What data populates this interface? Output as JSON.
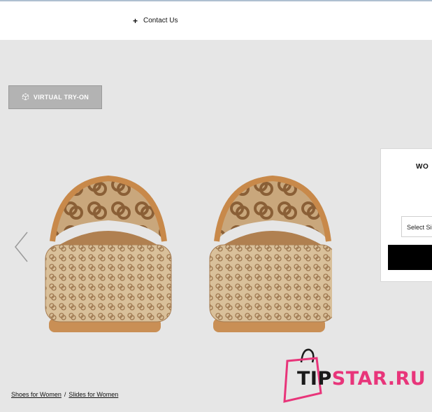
{
  "header": {
    "contact_label": "Contact Us"
  },
  "tryon": {
    "label": "VIRTUAL TRY-ON"
  },
  "panel": {
    "title": "WO",
    "size_select": "Select Si"
  },
  "breadcrumb": {
    "items": [
      "Shoes for Women",
      "Slides for Women"
    ],
    "separator": "/"
  },
  "watermark": {
    "part1": "TIP",
    "part2": "STAR.RU"
  },
  "colors": {
    "background": "#e6e6e6",
    "brand_pink": "#e8357a",
    "button_black": "#000000",
    "tryon_gray": "#b3b3b3"
  },
  "icons": [
    "plus-icon",
    "ar-cube-icon",
    "chevron-left-icon",
    "shopping-bag-icon"
  ]
}
